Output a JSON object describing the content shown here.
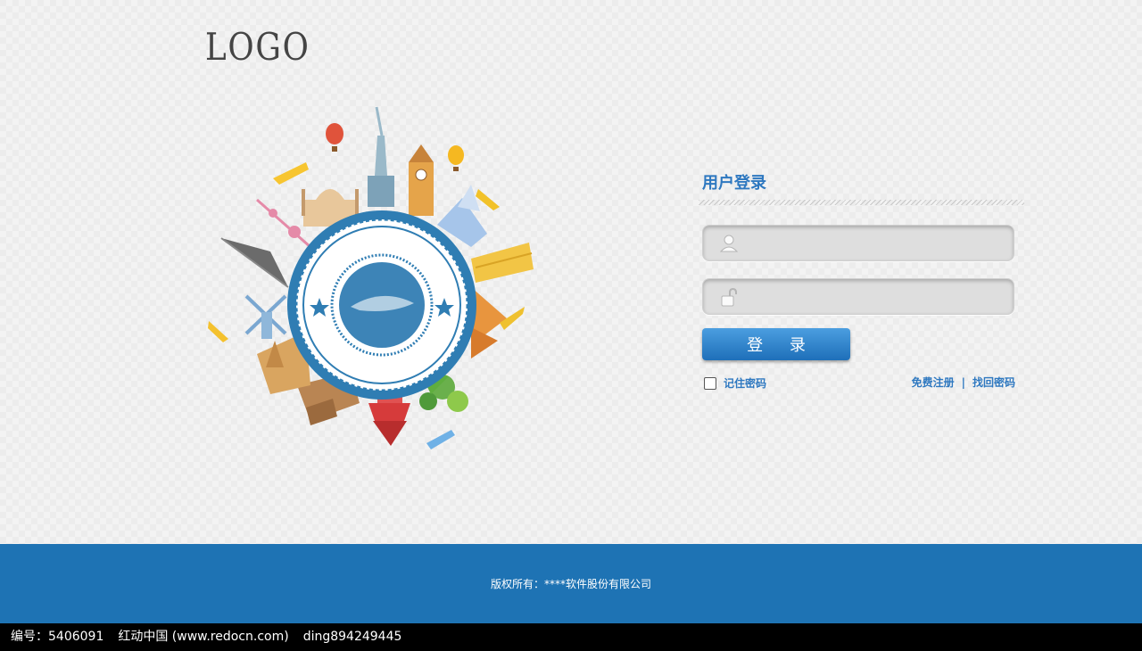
{
  "header": {
    "logo_text": "LOGO"
  },
  "login": {
    "title": "用户登录",
    "username": {
      "value": "",
      "placeholder": ""
    },
    "password": {
      "value": "",
      "placeholder": ""
    },
    "submit_label": "登 录",
    "remember_label": "记住密码",
    "remember_checked": false,
    "register_link": "免费注册",
    "link_separator": "|",
    "forgot_link": "找回密码"
  },
  "icons": {
    "username": "user-icon",
    "password": "lock-icon"
  },
  "colors": {
    "accent": "#2e78c0",
    "footer_bg": "#1e73b4",
    "button_top": "#4b9ee0",
    "button_bottom": "#1e6fb9"
  },
  "footer": {
    "copyright": "版权所有：****软件股份有限公司"
  },
  "watermark": {
    "id_label": "编号：5406091",
    "site": "红动中国 (www.redocn.com)",
    "author": "ding894249445"
  }
}
